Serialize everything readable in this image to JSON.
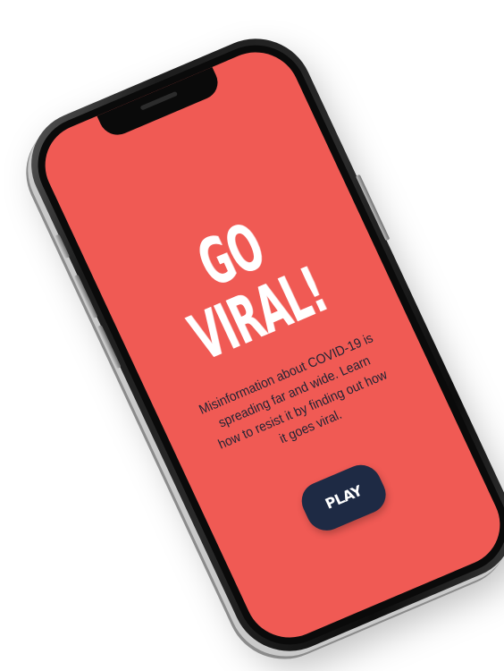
{
  "app": {
    "title": "GO VIRAL!",
    "description": "Misinformation about COVID-19 is spreading far and wide. Learn how to resist it by finding out how it goes viral.",
    "play_label": "PLAY"
  },
  "colors": {
    "screen_background": "#f05a54",
    "title_text": "#ffffff",
    "body_text": "#1f2333",
    "play_button_background": "#1e2a44",
    "play_button_text": "#ffffff"
  },
  "icons": {
    "notch": "notch",
    "speaker": "speaker-grille"
  }
}
